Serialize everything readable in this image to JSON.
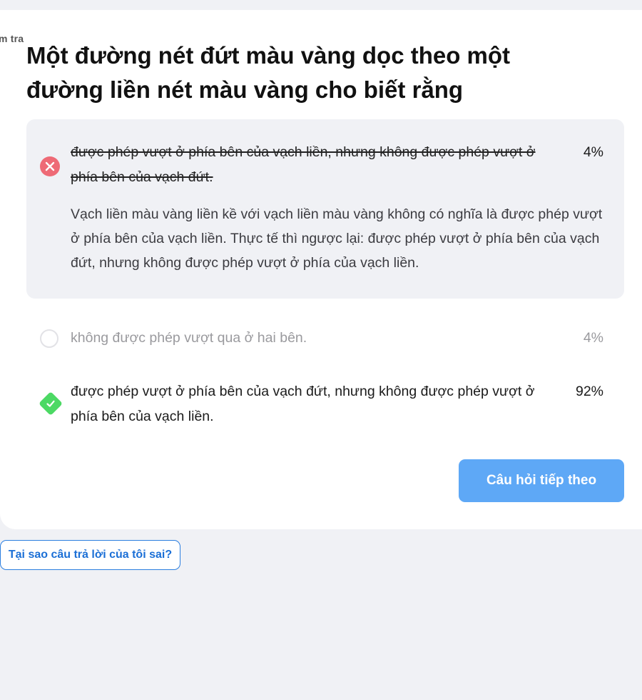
{
  "card": {
    "tag": "m tra",
    "question": "Một đường nét đứt màu vàng dọc theo một đường liền nét màu vàng cho biết rằng"
  },
  "options": [
    {
      "text": "được phép vượt ở phía bên của vạch liền, nhưng không được phép vượt ở phía bên của vạch đứt.",
      "percent": "4%",
      "state": "wrong-selected",
      "icon": "close-icon"
    },
    {
      "text": "không được phép vượt qua ở hai bên.",
      "percent": "4%",
      "state": "unselected",
      "icon": "empty-circle-icon"
    },
    {
      "text": "được phép vượt ở phía bên của vạch đứt, nhưng không được phép vượt ở phía bên của vạch liền.",
      "percent": "92%",
      "state": "correct",
      "icon": "check-icon"
    }
  ],
  "explanation": "Vạch liền màu vàng liền kề với vạch liền màu vàng không có nghĩa là được phép vượt ở phía bên của vạch liền. Thực tế thì ngược lại: được phép vượt ở phía bên của vạch đứt, nhưng không được phép vượt ở phía của vạch liền.",
  "buttons": {
    "next": "Câu hỏi tiếp theo",
    "why_wrong": "Tại sao câu trả lời của tôi sai?"
  },
  "colors": {
    "wrong": "#ee6a76",
    "correct": "#4cd964",
    "primary_button": "#5ea8f6",
    "link": "#1b6fd6",
    "background": "#f0f1f5"
  }
}
